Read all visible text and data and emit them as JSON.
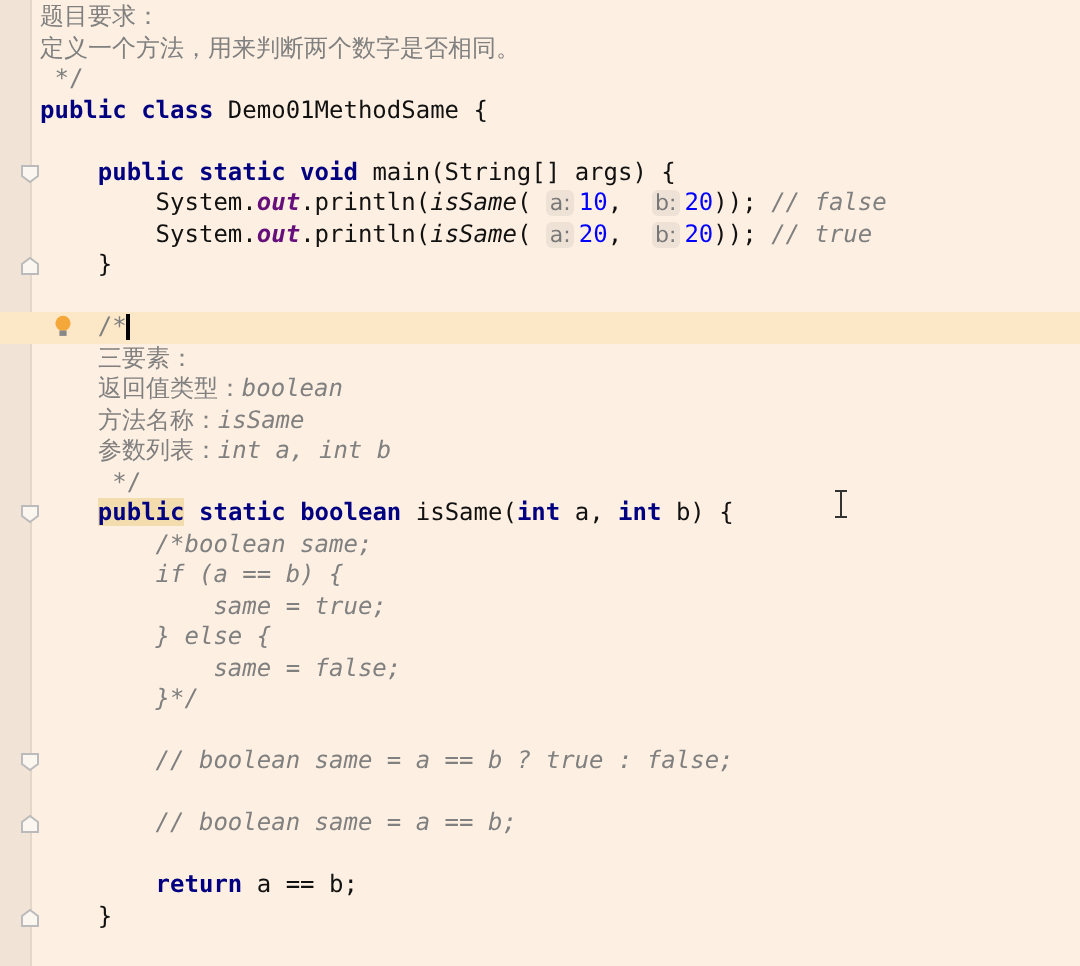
{
  "editor": {
    "lines": [
      {
        "kind": "code",
        "tokens": [
          {
            "kind": "comment-plain",
            "text": "题目要求："
          }
        ]
      },
      {
        "kind": "code",
        "tokens": [
          {
            "kind": "comment-plain",
            "text": "定义一个方法，用来判断两个数字是否相同。"
          }
        ]
      },
      {
        "kind": "code",
        "tokens": [
          {
            "kind": "comment-plain",
            "text": " */"
          }
        ]
      },
      {
        "kind": "code",
        "tokens": [
          {
            "kind": "keyword",
            "text": "public class "
          },
          {
            "kind": "plain",
            "text": "Demo01MethodSame {"
          }
        ]
      },
      {
        "kind": "blank"
      },
      {
        "kind": "code",
        "fold_start": true,
        "tokens": [
          {
            "kind": "keyword",
            "text": "    public static void "
          },
          {
            "kind": "plain",
            "text": "main(String[] args) {"
          }
        ]
      },
      {
        "kind": "code",
        "tokens": [
          {
            "kind": "plain",
            "text": "        System."
          },
          {
            "kind": "field",
            "text": "out"
          },
          {
            "kind": "plain",
            "text": ".println("
          },
          {
            "kind": "call",
            "text": "isSame"
          },
          {
            "kind": "plain",
            "text": "( "
          },
          {
            "kind": "hint",
            "text": "a:"
          },
          {
            "kind": "number",
            "text": "10"
          },
          {
            "kind": "plain",
            "text": ",  "
          },
          {
            "kind": "hint",
            "text": "b:"
          },
          {
            "kind": "number",
            "text": "20"
          },
          {
            "kind": "plain",
            "text": ")); "
          },
          {
            "kind": "comment",
            "text": "// false"
          }
        ]
      },
      {
        "kind": "code",
        "tokens": [
          {
            "kind": "plain",
            "text": "        System."
          },
          {
            "kind": "field",
            "text": "out"
          },
          {
            "kind": "plain",
            "text": ".println("
          },
          {
            "kind": "call",
            "text": "isSame"
          },
          {
            "kind": "plain",
            "text": "( "
          },
          {
            "kind": "hint",
            "text": "a:"
          },
          {
            "kind": "number",
            "text": "20"
          },
          {
            "kind": "plain",
            "text": ",  "
          },
          {
            "kind": "hint",
            "text": "b:"
          },
          {
            "kind": "number",
            "text": "20"
          },
          {
            "kind": "plain",
            "text": ")); "
          },
          {
            "kind": "comment",
            "text": "// true"
          }
        ]
      },
      {
        "kind": "code",
        "fold_end": true,
        "tokens": [
          {
            "kind": "plain",
            "text": "    }"
          }
        ]
      },
      {
        "kind": "blank"
      },
      {
        "kind": "code",
        "current": true,
        "bulb": true,
        "tokens": [
          {
            "kind": "comment-plain",
            "text": "    /*",
            "caret": true
          }
        ]
      },
      {
        "kind": "code",
        "tokens": [
          {
            "kind": "comment-plain",
            "text": "    三要素："
          }
        ]
      },
      {
        "kind": "code",
        "tokens": [
          {
            "kind": "comment-plain",
            "text": "    返回值类型："
          },
          {
            "kind": "comment",
            "text": "boolean"
          }
        ]
      },
      {
        "kind": "code",
        "tokens": [
          {
            "kind": "comment-plain",
            "text": "    方法名称："
          },
          {
            "kind": "comment",
            "text": "isSame"
          }
        ]
      },
      {
        "kind": "code",
        "tokens": [
          {
            "kind": "comment-plain",
            "text": "    参数列表："
          },
          {
            "kind": "comment",
            "text": "int a, int b"
          }
        ]
      },
      {
        "kind": "code",
        "tokens": [
          {
            "kind": "comment-plain",
            "text": "     */"
          }
        ]
      },
      {
        "kind": "code",
        "fold_start": true,
        "tokens": [
          {
            "kind": "keyword-highlight",
            "text": "    public"
          },
          {
            "kind": "keyword",
            "text": " static boolean "
          },
          {
            "kind": "plain",
            "text": "isSame("
          },
          {
            "kind": "keyword",
            "text": "int "
          },
          {
            "kind": "plain",
            "text": "a, "
          },
          {
            "kind": "keyword",
            "text": "int "
          },
          {
            "kind": "plain",
            "text": "b) {"
          }
        ]
      },
      {
        "kind": "code",
        "tokens": [
          {
            "kind": "comment",
            "text": "        /*boolean same;"
          }
        ]
      },
      {
        "kind": "code",
        "tokens": [
          {
            "kind": "comment",
            "text": "        if (a == b) {"
          }
        ]
      },
      {
        "kind": "code",
        "tokens": [
          {
            "kind": "comment",
            "text": "            same = true;"
          }
        ]
      },
      {
        "kind": "code",
        "tokens": [
          {
            "kind": "comment",
            "text": "        } else {"
          }
        ]
      },
      {
        "kind": "code",
        "tokens": [
          {
            "kind": "comment",
            "text": "            same = false;"
          }
        ]
      },
      {
        "kind": "code",
        "tokens": [
          {
            "kind": "comment",
            "text": "        }*/"
          }
        ]
      },
      {
        "kind": "blank"
      },
      {
        "kind": "code",
        "fold_start": true,
        "tokens": [
          {
            "kind": "comment",
            "text": "        // boolean same = a == b ? true : false;"
          }
        ]
      },
      {
        "kind": "blank"
      },
      {
        "kind": "code",
        "fold_end": true,
        "tokens": [
          {
            "kind": "comment",
            "text": "        // boolean same = a == b;"
          }
        ]
      },
      {
        "kind": "blank"
      },
      {
        "kind": "code",
        "tokens": [
          {
            "kind": "keyword",
            "text": "        return "
          },
          {
            "kind": "plain",
            "text": "a == b;"
          }
        ]
      },
      {
        "kind": "code",
        "fold_end": true,
        "tokens": [
          {
            "kind": "plain",
            "text": "    }"
          }
        ]
      }
    ]
  }
}
